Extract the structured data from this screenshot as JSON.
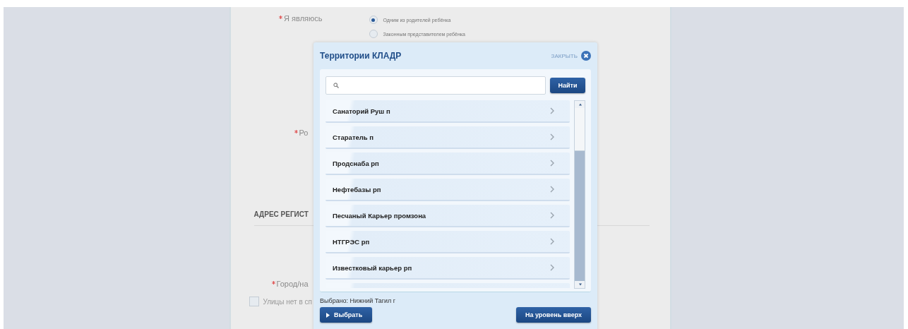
{
  "form": {
    "role": {
      "label": "Я являюсь",
      "required": true,
      "options": [
        {
          "label": "Одним из родителей ребёнка",
          "selected": true
        },
        {
          "label": "Законным представителем ребёнка",
          "selected": false
        }
      ]
    },
    "field_2": {
      "label": "Ро",
      "required": true
    },
    "section_title": "АДРЕС РЕГИСТ",
    "city": {
      "label": "Город/на",
      "required": true
    },
    "no_street": {
      "label": "Улицы нет в сп",
      "checked": false
    }
  },
  "dialog": {
    "title": "Территории КЛАДР",
    "close": "ЗАКРЫТЬ",
    "search": {
      "button": "Найти"
    },
    "items": [
      {
        "label": "Санаторий Руш п"
      },
      {
        "label": "Старатель п"
      },
      {
        "label": "Продснаба рп"
      },
      {
        "label": "Нефтебазы рп"
      },
      {
        "label": "Песчаный Карьер промзона"
      },
      {
        "label": "НТГРЭС рп"
      },
      {
        "label": "Известковый карьер рп"
      }
    ],
    "selected_text": "Выбрано: Нижний Тагил г",
    "choose": "Выбрать",
    "up": "На уровень вверх"
  }
}
